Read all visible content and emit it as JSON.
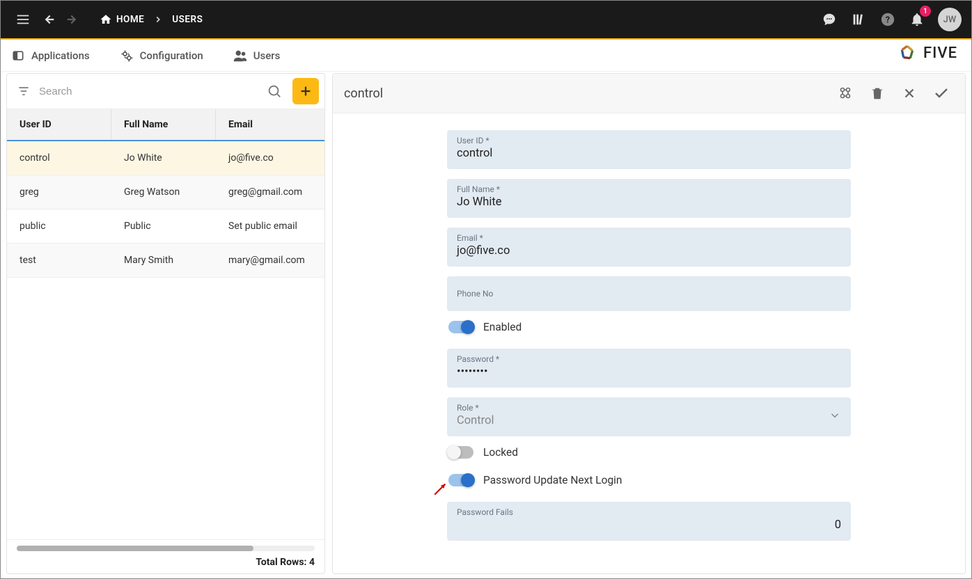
{
  "topbar": {
    "home_label": "HOME",
    "breadcrumb_current": "USERS",
    "notification_count": "1",
    "avatar_initials": "JW"
  },
  "tabs": {
    "applications": "Applications",
    "configuration": "Configuration",
    "users": "Users"
  },
  "brand": {
    "name": "FIVE"
  },
  "list": {
    "search_placeholder": "Search",
    "columns": {
      "user_id": "User ID",
      "full_name": "Full Name",
      "email": "Email"
    },
    "rows": [
      {
        "user_id": "control",
        "full_name": "Jo White",
        "email": "jo@five.co"
      },
      {
        "user_id": "greg",
        "full_name": "Greg Watson",
        "email": "greg@gmail.com"
      },
      {
        "user_id": "public",
        "full_name": "Public",
        "email": "Set public email"
      },
      {
        "user_id": "test",
        "full_name": "Mary Smith",
        "email": "mary@gmail.com"
      }
    ],
    "total_label": "Total Rows: ",
    "total_value": "4"
  },
  "detail": {
    "title": "control",
    "fields": {
      "user_id_label": "User ID *",
      "user_id_value": "control",
      "full_name_label": "Full Name *",
      "full_name_value": "Jo White",
      "email_label": "Email *",
      "email_value": "jo@five.co",
      "phone_label": "Phone No",
      "phone_value": "",
      "enabled_label": "Enabled",
      "password_label": "Password *",
      "password_value": "••••••••",
      "role_label": "Role *",
      "role_value": "Control",
      "locked_label": "Locked",
      "pw_update_label": "Password Update Next Login",
      "pw_fails_label": "Password Fails",
      "pw_fails_value": "0"
    }
  }
}
